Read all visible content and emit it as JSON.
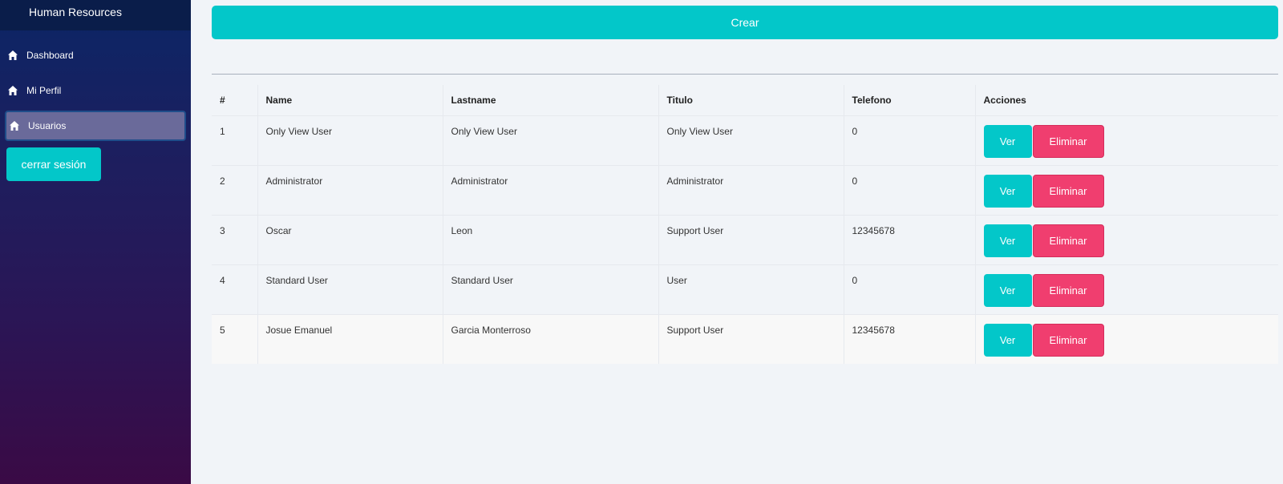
{
  "app": {
    "title": "Human Resources"
  },
  "sidebar": {
    "items": [
      {
        "label": "Dashboard",
        "icon": "home-icon"
      },
      {
        "label": "Mi Perfil",
        "icon": "home-icon"
      },
      {
        "label": "Usuarios",
        "icon": "home-icon",
        "active": true
      }
    ],
    "logout_label": "cerrar sesión"
  },
  "main": {
    "create_label": "Crear",
    "table": {
      "headers": [
        "#",
        "Name",
        "Lastname",
        "Titulo",
        "Telefono",
        "Acciones"
      ],
      "rows": [
        {
          "id": "1",
          "name": "Only View User",
          "lastname": "Only View User",
          "title": "Only View User",
          "phone": "0"
        },
        {
          "id": "2",
          "name": "Administrator",
          "lastname": "Administrator",
          "title": "Administrator",
          "phone": "0"
        },
        {
          "id": "3",
          "name": "Oscar",
          "lastname": "Leon",
          "title": "Support User",
          "phone": "12345678"
        },
        {
          "id": "4",
          "name": "Standard User",
          "lastname": "Standard User",
          "title": "User",
          "phone": "0"
        },
        {
          "id": "5",
          "name": "Josue Emanuel",
          "lastname": "Garcia Monterroso",
          "title": "Support User",
          "phone": "12345678"
        }
      ],
      "view_label": "Ver",
      "delete_label": "Eliminar"
    }
  },
  "colors": {
    "accent": "#03c7c9",
    "danger": "#f03e6f",
    "sidebar_top": "#0b2666",
    "sidebar_bottom": "#3a0a45"
  }
}
